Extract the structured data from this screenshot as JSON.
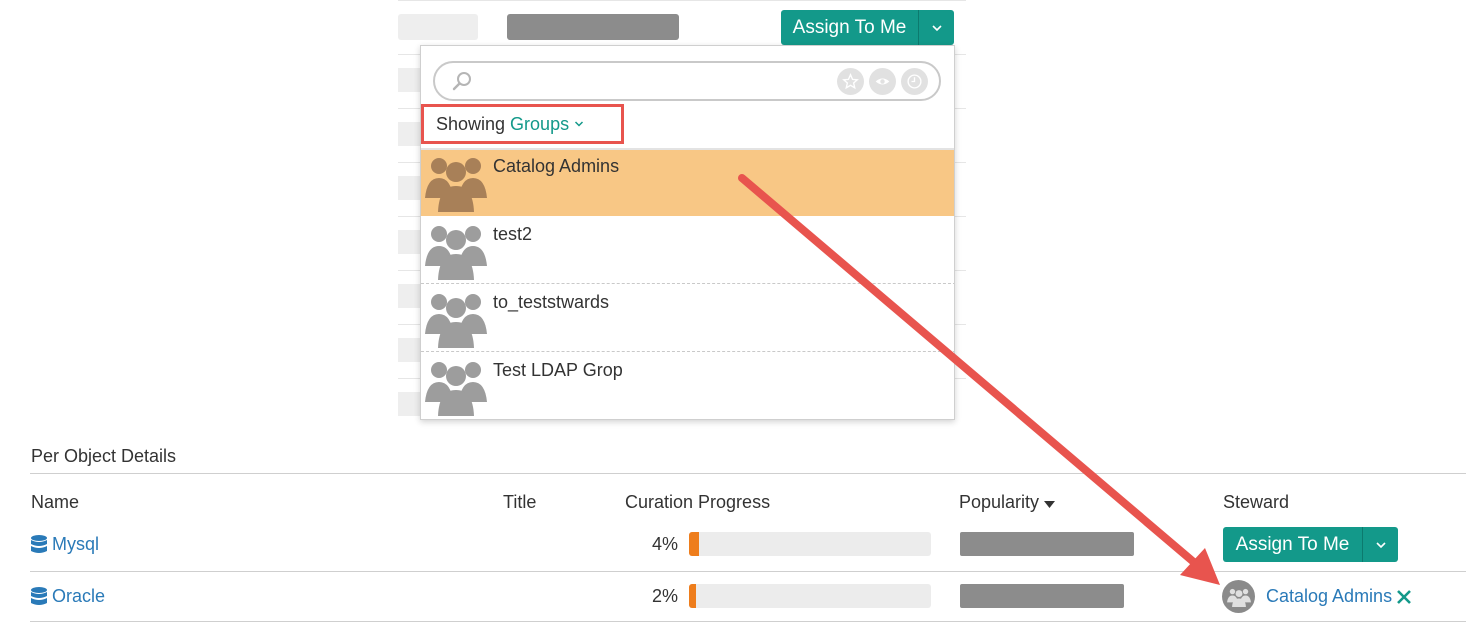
{
  "colors": {
    "accent": "#13998a",
    "link": "#2a7ab8",
    "selected_row": "#f8c785",
    "progress_fill": "#ee7d1c",
    "annotation": "#e8544e"
  },
  "top_assign": {
    "label": "Assign To Me",
    "caret_icon": "chevron-down-icon"
  },
  "dropdown": {
    "search": {
      "placeholder": "",
      "value": ""
    },
    "filters": [
      "star-icon",
      "eye-icon",
      "clock-icon"
    ],
    "showing_label": "Showing",
    "showing_value": "Groups",
    "items": [
      {
        "label": "Catalog Admins",
        "selected": true
      },
      {
        "label": "test2",
        "selected": false
      },
      {
        "label": "to_teststwards",
        "selected": false
      },
      {
        "label": "Test LDAP Grop",
        "selected": false
      }
    ]
  },
  "details": {
    "title": "Per Object Details",
    "columns": {
      "name": "Name",
      "title": "Title",
      "curation": "Curation Progress",
      "popularity": "Popularity",
      "steward": "Steward"
    },
    "rows": [
      {
        "name": "Mysql",
        "title": "",
        "curation_percent": "4%",
        "curation_fraction": 0.04,
        "steward_button": "Assign To Me"
      },
      {
        "name": "Oracle",
        "title": "",
        "curation_percent": "2%",
        "curation_fraction": 0.02,
        "steward_name": "Catalog Admins"
      }
    ]
  }
}
